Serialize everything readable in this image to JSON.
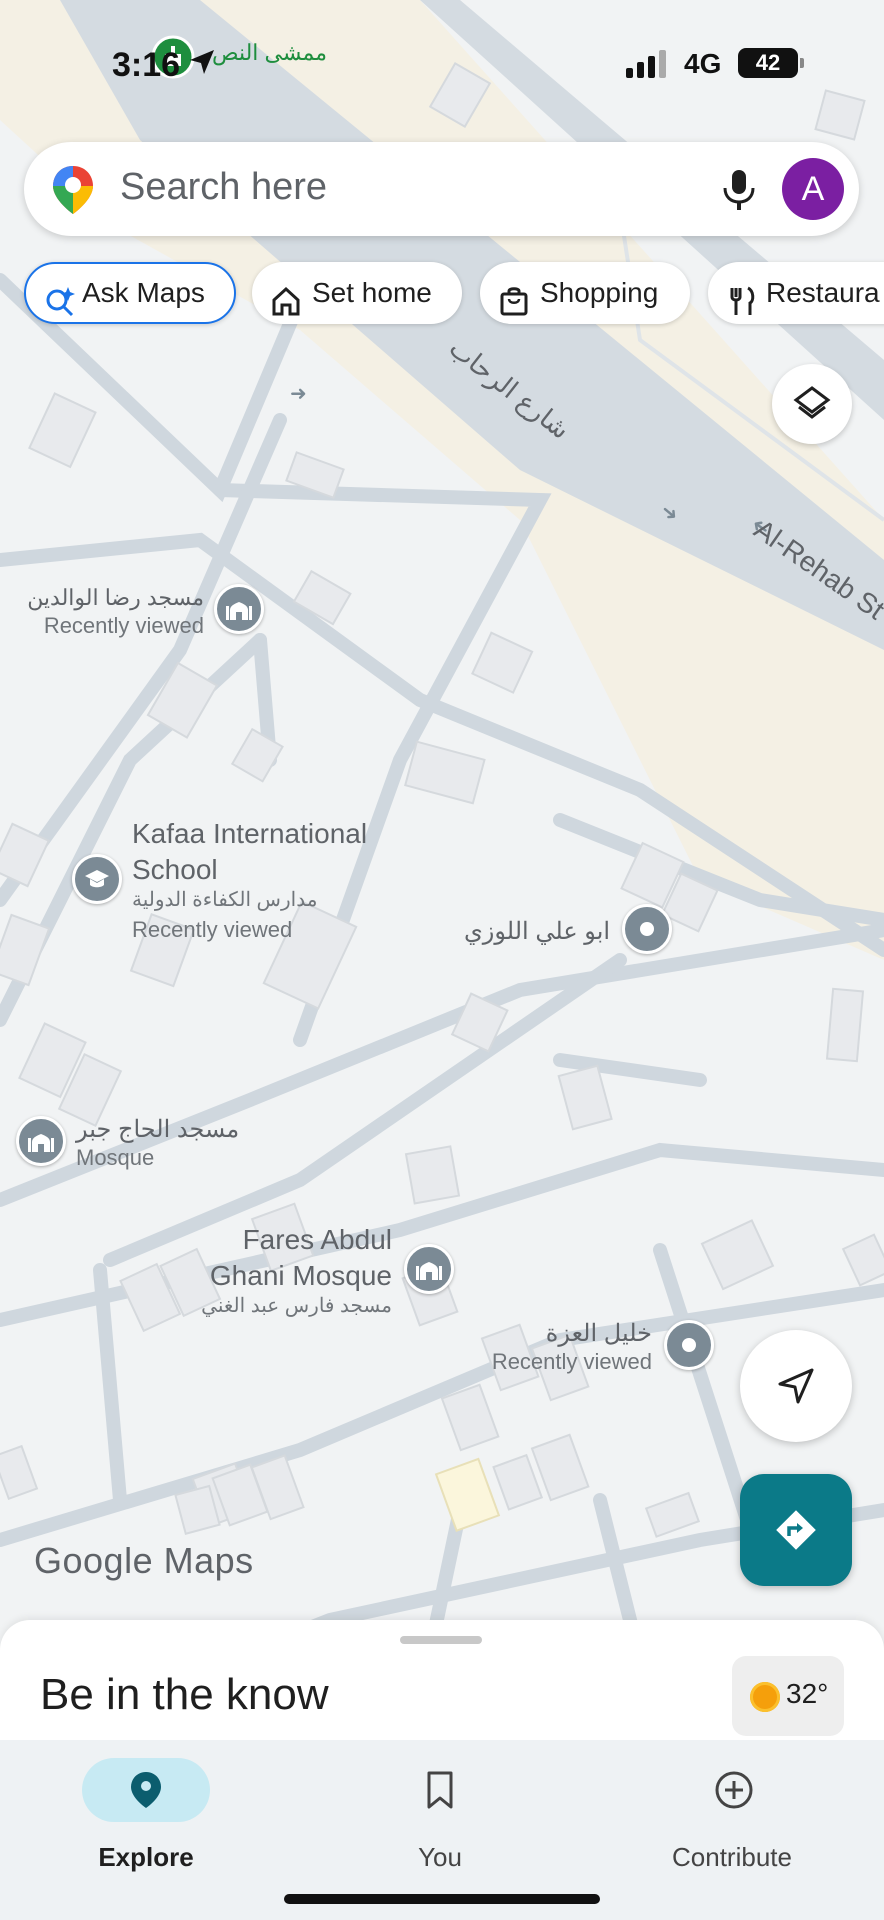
{
  "status_bar": {
    "time": "3:16",
    "nearby_place": "ممشى النص",
    "network": "4G",
    "battery": "42"
  },
  "search": {
    "placeholder": "Search here",
    "avatar_initial": "A",
    "mic_icon": "mic-icon",
    "pin_icon": "google-maps-pin-icon"
  },
  "chips": [
    {
      "label": "Ask Maps",
      "icon": "sparkle-search-icon"
    },
    {
      "label": "Set home",
      "icon": "home-icon"
    },
    {
      "label": "Shopping",
      "icon": "shopping-bag-icon"
    },
    {
      "label": "Restaura",
      "icon": "restaurant-icon"
    }
  ],
  "map": {
    "street_labels": [
      "شارع الرحاب",
      "Al-Rehab St"
    ],
    "places": [
      {
        "name": "مسجد رضا الوالدين",
        "sub": "Recently viewed",
        "icon": "mosque-icon"
      },
      {
        "name": "Kafaa International School",
        "name_line1": "Kafaa International",
        "name_line2": "School",
        "alt": "مدارس الكفاءة الدولية",
        "sub": "Recently viewed",
        "icon": "school-icon"
      },
      {
        "name": "ابو علي اللوزي",
        "icon": "place-icon"
      },
      {
        "name": "مسجد الحاج جبر",
        "sub": "Mosque",
        "icon": "mosque-icon"
      },
      {
        "name": "Fares Abdul Ghani Mosque",
        "name_line1": "Fares Abdul",
        "name_line2": "Ghani Mosque",
        "alt": "مسجد فارس عبد الغني",
        "icon": "mosque-icon"
      },
      {
        "name": "خليل العزة",
        "sub": "Recently viewed",
        "icon": "place-icon"
      }
    ],
    "logo": "Google Maps"
  },
  "sheet": {
    "title": "Be in the know",
    "temperature": "32°"
  },
  "nav": [
    {
      "label": "Explore",
      "icon": "explore-pin-icon",
      "active": true
    },
    {
      "label": "You",
      "icon": "bookmark-icon",
      "active": false
    },
    {
      "label": "Contribute",
      "icon": "plus-circle-icon",
      "active": false
    }
  ],
  "colors": {
    "accent": "#1a73e8",
    "avatar": "#7b1fa2",
    "directions": "#0b7a88",
    "explore_active": "#c7eaf3"
  }
}
